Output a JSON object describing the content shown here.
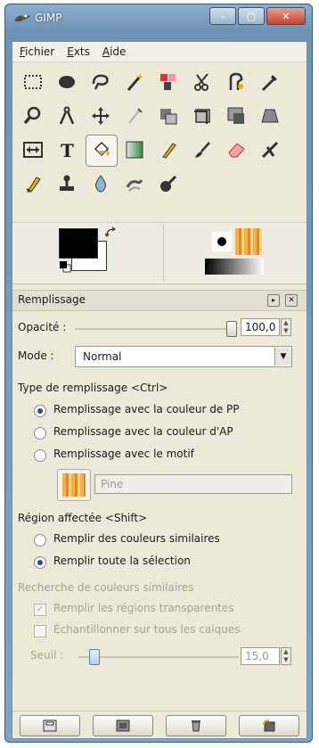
{
  "window": {
    "title": "GIMP",
    "minimize": "–",
    "maximize": "▢",
    "close": "✕"
  },
  "menu": [
    "Fichier",
    "Exts",
    "Aide"
  ],
  "tools": [
    "rect-select",
    "ellipse-select",
    "free-select",
    "fuzzy-select",
    "select-by-color",
    "scissors",
    "foreground-select",
    "paths",
    "color-picker",
    "zoom",
    "measure",
    "move",
    "align",
    "crop",
    "rotate",
    "scale",
    "shear",
    "perspective",
    "flip",
    "text",
    "bucket-fill",
    "blend",
    "pencil",
    "paintbrush",
    "eraser",
    "airbrush",
    "ink",
    "clone",
    "heal",
    "perspective-clone",
    "blur",
    "smudge"
  ],
  "tool_options": {
    "panel_title": "Remplissage",
    "opacity_label": "Opacité :",
    "opacity_value": "100,0",
    "mode_label": "Mode :",
    "mode_value": "Normal",
    "fill_type_title": "Type de remplissage  <Ctrl>",
    "fill_types": [
      {
        "label": "Remplissage avec la couleur de PP",
        "selected": true
      },
      {
        "label": "Remplissage avec la couleur d'AP",
        "selected": false
      },
      {
        "label": "Remplissage avec le motif",
        "selected": false
      }
    ],
    "pattern_name": "Pine",
    "region_title": "Région affectée  <Shift>",
    "regions": [
      {
        "label": "Remplir des couleurs similaires",
        "selected": false
      },
      {
        "label": "Remplir toute la sélection",
        "selected": true
      }
    ],
    "similar_title": "Recherche de couleurs similaires",
    "similar_checks": [
      {
        "label": "Remplir les régions transparentes",
        "checked": true
      },
      {
        "label": "Échantillonner sur tous les calques",
        "checked": false
      }
    ],
    "threshold_label": "Seuil :",
    "threshold_value": "15,0"
  },
  "colors": {
    "foreground": "#000000",
    "background": "#ffffff",
    "gradient_color": "#f0a33a"
  }
}
